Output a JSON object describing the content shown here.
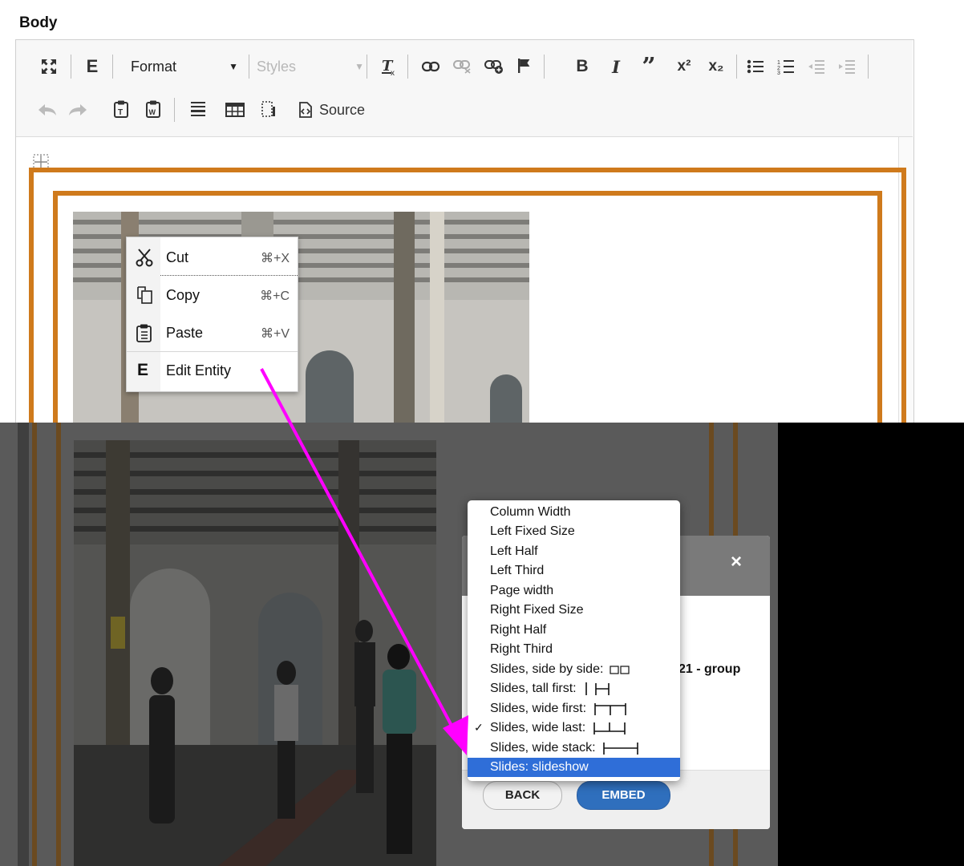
{
  "field_label": "Body",
  "toolbar": {
    "row1": {
      "maximize": "maximize-icon",
      "entity_embed": "E",
      "format_combo": "Format",
      "styles_combo": "Styles",
      "remove_format": "remove-format-icon",
      "link": "link-icon",
      "unlink": "unlink-icon",
      "add_link": "add-link-icon",
      "anchor": "flag-icon",
      "bold": "B",
      "italic": "I",
      "blockquote": "quote-icon",
      "superscript": "x²",
      "subscript": "x₂",
      "bulleted_list": "bulleted-list-icon",
      "numbered_list": "numbered-list-icon",
      "outdent": "outdent-icon",
      "indent": "indent-icon"
    },
    "row2": {
      "undo": "undo-icon",
      "redo": "redo-icon",
      "paste_text": "paste-text-icon",
      "paste_word": "paste-word-icon",
      "horizontal_rule": "horizontal-rule-icon",
      "table": "table-icon",
      "show_blocks": "show-blocks-icon",
      "source_label": "Source"
    }
  },
  "context_menu": {
    "items": [
      {
        "label": "Cut",
        "shortcut": "⌘+X",
        "icon": "scissors-icon"
      },
      {
        "label": "Copy",
        "shortcut": "⌘+C",
        "icon": "copy-icon"
      },
      {
        "label": "Paste",
        "shortcut": "⌘+V",
        "icon": "paste-icon"
      },
      {
        "label": "Edit Entity",
        "shortcut": "",
        "icon": "E"
      }
    ]
  },
  "dialog": {
    "close_label": "×",
    "partial_text": "21 - group",
    "back_label": "BACK",
    "embed_label": "EMBED"
  },
  "display_dropdown": {
    "options": [
      "Column Width",
      "Left Fixed Size",
      "Left Half",
      "Left Third",
      "Page width",
      "Right Fixed Size",
      "Right Half",
      "Right Third",
      "Slides, side by side:",
      "Slides, tall first:",
      "Slides, wide first:",
      "Slides, wide last:",
      "Slides, wide stack:",
      "Slides: slideshow"
    ],
    "checked": "Slides, wide last:",
    "highlighted": "Slides: slideshow"
  },
  "colors": {
    "frame_orange": "#cf7a1c",
    "arrow_magenta": "#ff00ff",
    "highlight_blue": "#2f6ed8",
    "embed_button": "#2f6fbd"
  }
}
